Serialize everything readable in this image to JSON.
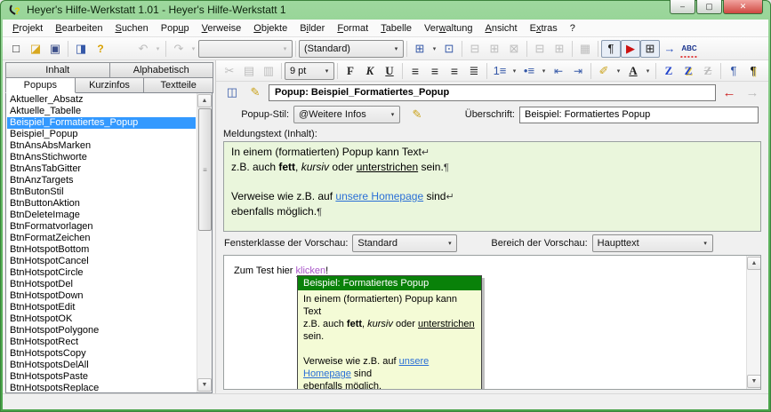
{
  "window": {
    "title": "Heyer's Hilfe-Werkstatt 1.01 - Heyer's Hilfe-Werkstatt 1"
  },
  "icons": {
    "back_arrow": "←",
    "forward_arrow": "→",
    "pencil": "✎",
    "topic_window": "◫",
    "scroll_up": "▲",
    "scroll_down": "▼",
    "grip": "≡",
    "dropdown": "▾",
    "minimize": "–",
    "maximize": "▢",
    "close": "✕"
  },
  "colors": {
    "titlebar_green": "#5cb35c",
    "selection_blue": "#3399ff",
    "editor_green": "#eaf6dc",
    "popup_title_green": "#098109",
    "popup_body": "#f4fbd6",
    "link_blue": "#2a6fd6"
  },
  "menu": {
    "items": [
      {
        "name": "menu-projekt",
        "pre": "",
        "accel": "P",
        "post": "rojekt"
      },
      {
        "name": "menu-bearbeiten",
        "pre": "",
        "accel": "B",
        "post": "earbeiten"
      },
      {
        "name": "menu-suchen",
        "pre": "",
        "accel": "S",
        "post": "uchen"
      },
      {
        "name": "menu-popup",
        "pre": "Pop",
        "accel": "u",
        "post": "p"
      },
      {
        "name": "menu-verweise",
        "pre": "",
        "accel": "V",
        "post": "erweise"
      },
      {
        "name": "menu-objekte",
        "pre": "",
        "accel": "O",
        "post": "bjekte"
      },
      {
        "name": "menu-bilder",
        "pre": "B",
        "accel": "i",
        "post": "lder"
      },
      {
        "name": "menu-format",
        "pre": "",
        "accel": "F",
        "post": "ormat"
      },
      {
        "name": "menu-tabelle",
        "pre": "",
        "accel": "T",
        "post": "abelle"
      },
      {
        "name": "menu-verwaltung",
        "pre": "Ver",
        "accel": "w",
        "post": "altung"
      },
      {
        "name": "menu-ansicht",
        "pre": "",
        "accel": "A",
        "post": "nsicht"
      },
      {
        "name": "menu-extras",
        "pre": "E",
        "accel": "x",
        "post": "tras"
      },
      {
        "name": "menu-hilfe",
        "pre": "",
        "accel": "",
        "post": "?"
      }
    ]
  },
  "toolbar1": {
    "left": [
      {
        "name": "new-project-button",
        "glyph": "□",
        "cls": "ic"
      },
      {
        "name": "open-project-button",
        "glyph": "◪",
        "cls": "ic c-yel"
      },
      {
        "name": "save-button",
        "glyph": "▣",
        "cls": "ic c-sav"
      },
      {
        "name": "separator",
        "cls": "sep",
        "ia": "false"
      },
      {
        "name": "project-properties-button",
        "glyph": "◨",
        "cls": "ic c-blu"
      },
      {
        "name": "help-topics-button",
        "glyph": "?",
        "cls": "ic c-help"
      },
      {
        "name": "spacer",
        "cls": "spc",
        "ia": "false"
      },
      {
        "name": "undo-button",
        "glyph": "↶",
        "cls": "ic dis"
      },
      {
        "name": "undo-dropdown",
        "glyph": "▾",
        "cls": "drop dis"
      },
      {
        "name": "separator",
        "cls": "sep",
        "ia": "false"
      },
      {
        "name": "redo-button",
        "glyph": "↷",
        "cls": "ic dis"
      },
      {
        "name": "redo-dropdown",
        "glyph": "▾",
        "cls": "drop dis"
      }
    ],
    "combo_style_empty": "",
    "combo_para_style": "(Standard)",
    "right": [
      {
        "name": "insert-table-button",
        "glyph": "⊞",
        "cls": "ic c-blu"
      },
      {
        "name": "insert-table-dropdown",
        "glyph": "▾",
        "cls": "drop"
      },
      {
        "name": "table-properties-button",
        "glyph": "⊡",
        "cls": "ic c-blu"
      },
      {
        "name": "separator",
        "cls": "sep",
        "ia": "false"
      },
      {
        "name": "row-insert-button",
        "glyph": "⊟",
        "cls": "ic dis"
      },
      {
        "name": "row-delete-button",
        "glyph": "⊞",
        "cls": "ic dis"
      },
      {
        "name": "cell-split-button",
        "glyph": "⊠",
        "cls": "ic dis"
      },
      {
        "name": "separator",
        "cls": "sep",
        "ia": "false"
      },
      {
        "name": "column-insert-button",
        "glyph": "⊟",
        "cls": "ic dis"
      },
      {
        "name": "column-delete-button",
        "glyph": "⊞",
        "cls": "ic dis"
      },
      {
        "name": "separator",
        "cls": "sep",
        "ia": "false"
      },
      {
        "name": "table-design-button",
        "glyph": "▦",
        "cls": "ic dis"
      },
      {
        "name": "separator",
        "cls": "sep",
        "ia": "false"
      },
      {
        "name": "show-paragraph-marks-toggle",
        "glyph": "¶",
        "cls": "ic pressed"
      },
      {
        "name": "preview-play-toggle",
        "glyph": "▶",
        "cls": "ic pressed c-red"
      },
      {
        "name": "show-table-grid-toggle",
        "glyph": "⊞",
        "cls": "ic pressed"
      },
      {
        "name": "goto-target-button",
        "glyph": "→",
        "cls": "ic c-blu2"
      },
      {
        "name": "spellcheck-button",
        "glyph": "ABC",
        "cls": "ic abc"
      }
    ]
  },
  "toolbar2": {
    "left": [
      {
        "name": "cut-button",
        "glyph": "✂",
        "cls": "ic dis"
      },
      {
        "name": "copy-button",
        "glyph": "▤",
        "cls": "ic dis"
      },
      {
        "name": "paste-button",
        "glyph": "▥",
        "cls": "ic dis"
      },
      {
        "name": "separator",
        "cls": "sep",
        "ia": "false"
      }
    ],
    "font_size": "9 pt",
    "right": [
      {
        "name": "separator",
        "cls": "sep",
        "ia": "false"
      },
      {
        "name": "bold-button",
        "glyph": "F",
        "cls": "ic b"
      },
      {
        "name": "italic-button",
        "glyph": "K",
        "cls": "ic i"
      },
      {
        "name": "underline-button",
        "glyph": "U",
        "cls": "ic u"
      },
      {
        "name": "separator",
        "cls": "sep",
        "ia": "false"
      },
      {
        "name": "align-left-button",
        "glyph": "≡",
        "cls": "ic al"
      },
      {
        "name": "align-center-button",
        "glyph": "≡",
        "cls": "ic ac"
      },
      {
        "name": "align-right-button",
        "glyph": "≡",
        "cls": "ic ar"
      },
      {
        "name": "align-justify-button",
        "glyph": "≣",
        "cls": "ic"
      },
      {
        "name": "separator",
        "cls": "sep",
        "ia": "false"
      },
      {
        "name": "numbered-list-button",
        "glyph": "1≡",
        "cls": "ic c-blu",
        "small": true
      },
      {
        "name": "numbered-list-dropdown",
        "glyph": "▾",
        "cls": "drop"
      },
      {
        "name": "bullet-list-button",
        "glyph": "•≡",
        "cls": "ic c-blu"
      },
      {
        "name": "bullet-list-dropdown",
        "glyph": "▾",
        "cls": "drop"
      },
      {
        "name": "decrease-indent-button",
        "glyph": "⇤",
        "cls": "ic c-ind"
      },
      {
        "name": "increase-indent-button",
        "glyph": "⇥",
        "cls": "ic c-ind"
      },
      {
        "name": "separator",
        "cls": "sep",
        "ia": "false"
      },
      {
        "name": "highlight-button",
        "glyph": "✐",
        "cls": "ic c-yel2"
      },
      {
        "name": "highlight-dropdown",
        "glyph": "▾",
        "cls": "drop"
      },
      {
        "name": "font-color-button",
        "glyph": "A",
        "cls": "ic u"
      },
      {
        "name": "font-color-dropdown",
        "glyph": "▾",
        "cls": "drop"
      },
      {
        "name": "separator",
        "cls": "sep",
        "ia": "false"
      },
      {
        "name": "char-style-button",
        "glyph": "Z",
        "cls": "ic zb"
      },
      {
        "name": "char-style-apply-button",
        "glyph": "Z",
        "cls": "ic zy"
      },
      {
        "name": "char-style-clear-button",
        "glyph": "Z",
        "cls": "ic dis zs"
      },
      {
        "name": "separator",
        "cls": "sep",
        "ia": "false"
      },
      {
        "name": "para-style-button",
        "glyph": "¶",
        "cls": "ic c-blu"
      },
      {
        "name": "para-style-apply-button",
        "glyph": "¶",
        "cls": "ic zy2"
      },
      {
        "name": "para-style-clear-button",
        "glyph": "¶",
        "cls": "ic dis"
      }
    ]
  },
  "sidebar": {
    "tabs_top": [
      {
        "name": "tab-inhalt",
        "label": "Inhalt"
      },
      {
        "name": "tab-alphabetisch",
        "label": "Alphabetisch"
      }
    ],
    "tabs_bottom": [
      {
        "name": "tab-popups",
        "label": "Popups",
        "cls": "active"
      },
      {
        "name": "tab-kurzinfos",
        "label": "Kurzinfos"
      },
      {
        "name": "tab-textteile",
        "label": "Textteile"
      }
    ],
    "items": [
      {
        "label": "Aktueller_Absatz"
      },
      {
        "label": "Aktuelle_Tabelle"
      },
      {
        "label": "Beispiel_Formatiertes_Popup",
        "cls": "selected"
      },
      {
        "label": "Beispiel_Popup"
      },
      {
        "label": "BtnAnsAbsMarken"
      },
      {
        "label": "BtnAnsStichworte"
      },
      {
        "label": "BtnAnsTabGitter"
      },
      {
        "label": "BtnAnzTargets"
      },
      {
        "label": "BtnButonStil"
      },
      {
        "label": "BtnButtonAktion"
      },
      {
        "label": "BtnDeleteImage"
      },
      {
        "label": "BtnFormatvorlagen"
      },
      {
        "label": "BtnFormatZeichen"
      },
      {
        "label": "BtnHotspotBottom"
      },
      {
        "label": "BtnHotspotCancel"
      },
      {
        "label": "BtnHotspotCircle"
      },
      {
        "label": "BtnHotspotDel"
      },
      {
        "label": "BtnHotspotDown"
      },
      {
        "label": "BtnHotspotEdit"
      },
      {
        "label": "BtnHotspotOK"
      },
      {
        "label": "BtnHotspotPolygone"
      },
      {
        "label": "BtnHotspotRect"
      },
      {
        "label": "BtnHotspotsCopy"
      },
      {
        "label": "BtnHotspotsDelAll"
      },
      {
        "label": "BtnHotspotsPaste"
      },
      {
        "label": "BtnHotspotsReplace"
      }
    ]
  },
  "header": {
    "topic": "Popup: Beispiel_Formatiertes_Popup"
  },
  "form": {
    "style_label": "Popup-Stil:",
    "style_value": "@Weitere Infos",
    "heading_label": "Überschrift:",
    "heading_value": "Beispiel: Formatiertes Popup",
    "message_label": "Meldungstext (Inhalt):"
  },
  "content": {
    "l1": "In einem (formatierten) Popup kann Text",
    "lb": "↵",
    "pm": "¶",
    "l2a": "z.B. auch ",
    "l2_bold": "fett",
    "l2b": ", ",
    "l2_italic": "kursiv",
    "l2c": " oder ",
    "l2_under": "unterstrichen",
    "l2d": " sein.",
    "l3a": "Verweise wie z.B. auf ",
    "l3_link": "unsere Homepage",
    "l3b": " sind",
    "l4": "ebenfalls möglich."
  },
  "preview": {
    "class_label": "Fensterklasse der Vorschau:",
    "class_value": "Standard",
    "area_label": "Bereich der Vorschau:",
    "area_value": "Haupttext",
    "test_pre": "Zum Test hier ",
    "test_link": "klicken",
    "test_post": "!",
    "popup_title": "Beispiel: Formatiertes Popup"
  }
}
